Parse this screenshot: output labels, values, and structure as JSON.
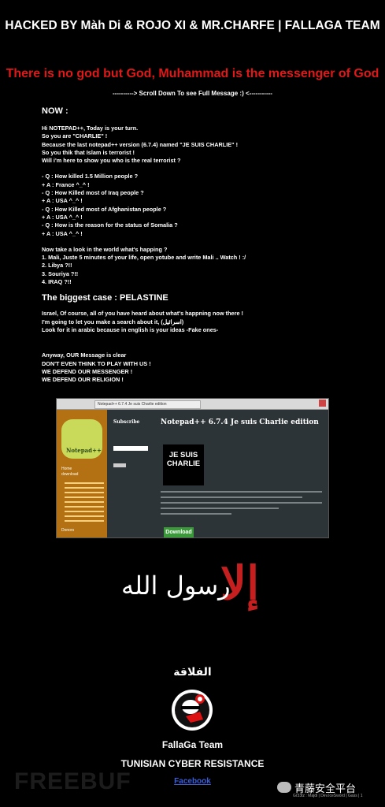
{
  "header": {
    "title": "HACKED BY Màh Di & ROJO XI & MR.CHARFE | FALLAGA TEAM",
    "slogan": "There is no god but God, Muhammad is the messenger of God",
    "scroll_hint": "----------> Scroll Down To see Full Message :) <-----------"
  },
  "message": {
    "now_heading": "NOW :",
    "intro": [
      "Hi NOTEPAD++, Today is your turn.",
      "So you are \"CHARLIE\" !",
      "Because the last notepad++ version (6.7.4) named \"JE SUIS CHARLIE\" !",
      "So you thik that Islam is terrorist !",
      "Will i'm here to show you who is the real terrorist ?"
    ],
    "qa": [
      "- Q : How killed 1.5 Million people ?",
      "+ A : France ^_^ !",
      "- Q : How Killed most of Iraq people ?",
      "+ A : USA ^_^ !",
      "- Q : How Killed most of Afghanistan people ?",
      "+ A : USA ^_^ !",
      "- Q : How is the reason for the status of Somalia ?",
      "+ A : USA ^_^ !"
    ],
    "world": [
      "Now take a look in the world what's happing ?",
      "1. Mali, Juste 5 minutes of your life, open yotube and write Mali .. Watch ! :/",
      "2. Libya ?!!",
      "3. Souriya ?!!",
      "4. IRAQ ?!!"
    ],
    "case_heading": "The biggest case : PELASTINE",
    "israel": [
      "Israel, Of course, all of you have heard about what's happning now there !",
      "I'm going to let you make a search about it, (اسرائيل)",
      "Look for it in arabic because in english is your ideas -Fake ones-"
    ],
    "closing": [
      "Anyway, OUR Message is clear",
      "DON'T EVEN THINK TO PLAY WITH US !",
      "WE DEFEND OUR MESSENGER !",
      "WE DEFEND OUR RELIGION !"
    ]
  },
  "embedded_screenshot": {
    "tab_title": "Notepad++ 6.7.4 Je suis Charlie edition",
    "logo_text": "Notepad++",
    "sidebar_nav": [
      "Home",
      "download"
    ],
    "sidebar_footer": "Donors",
    "subscribe_label": "Subscribe",
    "subscribe_button": "Subscribe",
    "page_heading": "Notepad++ 6.7.4  Je suis Charlie edition",
    "charlie_badge": "JE SUIS CHARLIE",
    "download_button": "Download"
  },
  "footer": {
    "arabic_calligraphy_red": "إلا",
    "arabic_calligraphy_white": "رسول الله",
    "team_arabic": "الفلاقة",
    "team_name": "FallaGa Team",
    "resistance": "TUNISIAN CYBER RESISTANCE",
    "facebook_link": "Facebook",
    "watermark": "FREEBUF",
    "wechat_account": "青藤安全平台",
    "credits": "Gr33tz : Majdi | Dev.IceSword | Gass | 1"
  },
  "colors": {
    "background": "#000000",
    "slogan_red": "#e01818",
    "link_blue": "#3b5ed9",
    "calligraphy_red": "#c51f1f"
  }
}
